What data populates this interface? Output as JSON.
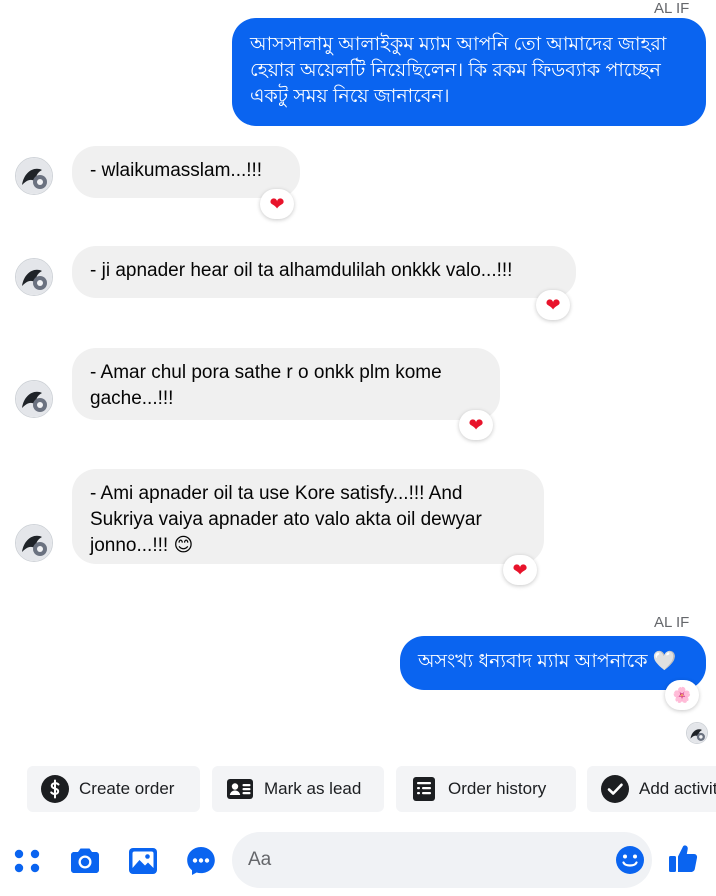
{
  "messages": [
    {
      "sender": "AL IF",
      "text": "আসসালামু আলাইকুম ম্যাম আপনি তো আমাদের জাহরা হেয়ার অয়েলটি নিয়েছিলেন। কি রকম ফিডব্যাক পাচ্ছেন একটু সময় নিয়ে জানাবেন।"
    },
    {
      "text": "- wlaikumasslam...!!!",
      "reaction": "❤"
    },
    {
      "text": "- ji apnader hear oil ta alhamdulilah onkkk valo...!!!",
      "reaction": "❤"
    },
    {
      "text": "- Amar chul pora sathe r o onkk plm kome gache...!!!",
      "reaction": "❤"
    },
    {
      "text": "- Ami apnader oil ta use Kore satisfy...!!! And Sukriya vaiya apnader ato valo akta oil dewyar jonno...!!! 😊",
      "reaction": "❤"
    },
    {
      "sender": "AL IF",
      "text": "অসংখ্য ধন্যবাদ ম্যাম আপনাকে 🤍",
      "reaction": "🌸"
    }
  ],
  "quick_actions": [
    {
      "label": "Create order",
      "icon": "dollar-icon"
    },
    {
      "label": "Mark as lead",
      "icon": "contact-card-icon"
    },
    {
      "label": "Order history",
      "icon": "receipt-icon"
    },
    {
      "label": "Add activity",
      "icon": "checkmark-circle-icon"
    }
  ],
  "composer": {
    "placeholder": "Aa"
  },
  "toolbar_icons": [
    "apps-icon",
    "camera-icon",
    "gallery-icon",
    "messenger-icon",
    "emoji-icon",
    "thumbs-up-icon"
  ],
  "colors": {
    "accent": "#0a64f0",
    "incoming_bubble": "#f0f0f0",
    "reaction_heart": "#e8132b",
    "chip_background": "#f3f4f6"
  }
}
